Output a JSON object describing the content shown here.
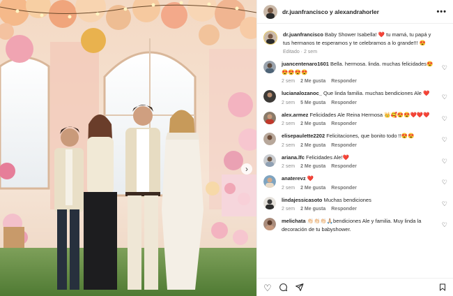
{
  "post": {
    "header_names": "dr.juanfrancisco y alexandrahorler",
    "caption": {
      "user": "dr.juanfrancisco",
      "text": "Baby Shower Isabella! ❤️ tu mamá, tu papá y tus hermanos te esperamos y te celebramos a lo grande!!! 😍",
      "meta": "Editado · 2 sem"
    }
  },
  "comments": [
    {
      "user": "juancentenaro1601",
      "text": "Bella. hermosa. linda. muchas felicidades😍😍😍😍😍",
      "time": "2 sem",
      "likes": "2 Me gusta",
      "reply": "Responder"
    },
    {
      "user": "lucianalozanoc_",
      "text": "Que linda familia. muchas bendiciones Ale ❤️",
      "time": "2 sem",
      "likes": "5 Me gusta",
      "reply": "Responder"
    },
    {
      "user": "alex.armez",
      "text": "Felicidades Ale Reina Hermosa 👑🥰😍😍❤️❤️❤️",
      "time": "2 sem",
      "likes": "2 Me gusta",
      "reply": "Responder"
    },
    {
      "user": "elisepaulette2202",
      "text": "Felicitaciones, que bonito todo !!😍😍",
      "time": "2 sem",
      "likes": "2 Me gusta",
      "reply": "Responder"
    },
    {
      "user": "ariana.lfc",
      "text": "Felicidades Ale!❤️",
      "time": "2 sem",
      "likes": "2 Me gusta",
      "reply": "Responder"
    },
    {
      "user": "anaterevz",
      "text": "❤️",
      "time": "2 sem",
      "likes": "2 Me gusta",
      "reply": "Responder"
    },
    {
      "user": "lindajessicasoto",
      "text": "Muchas bendiciones",
      "time": "2 sem",
      "likes": "2 Me gusta",
      "reply": "Responder"
    },
    {
      "user": "melichata",
      "text": "👏🏻👏🏻👏🏻🙏🏼bendiciones Ale y familia. Muy linda la decoración de tu babyshower.",
      "time": "",
      "likes": "",
      "reply": ""
    }
  ],
  "icons": {
    "more": "more-options-icon",
    "heart": "heart-icon",
    "comment": "comment-icon",
    "share": "share-icon",
    "save": "bookmark-icon",
    "next": "chevron-right-icon"
  }
}
